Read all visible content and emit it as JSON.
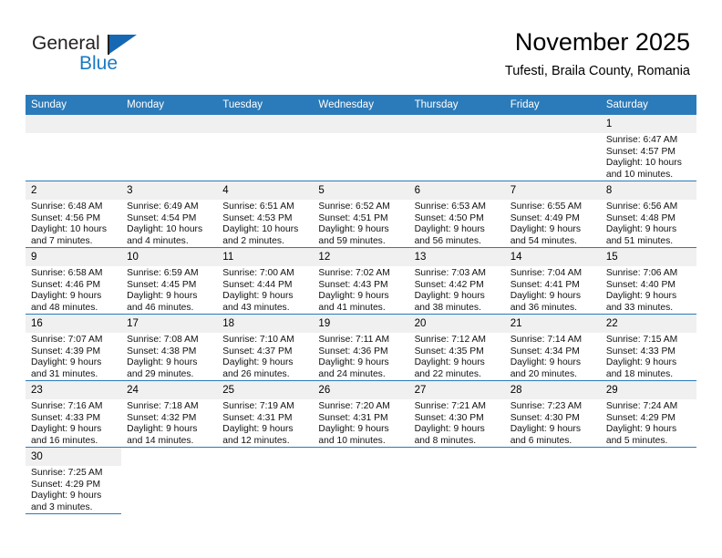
{
  "brand": {
    "name_top": "General",
    "name_bottom": "Blue",
    "accent_color": "#1668b3"
  },
  "header": {
    "title": "November 2025",
    "subtitle": "Tufesti, Braila County, Romania"
  },
  "theme": {
    "header_blue": "#2b7bba",
    "daynum_band": "#f0f0f0",
    "text": "#000000"
  },
  "weekday_headers": [
    "Sunday",
    "Monday",
    "Tuesday",
    "Wednesday",
    "Thursday",
    "Friday",
    "Saturday"
  ],
  "labels": {
    "sunrise": "Sunrise:",
    "sunset": "Sunset:",
    "daylight": "Daylight:"
  },
  "weeks": [
    [
      {
        "empty": true
      },
      {
        "empty": true
      },
      {
        "empty": true
      },
      {
        "empty": true
      },
      {
        "empty": true
      },
      {
        "empty": true
      },
      {
        "day": "1",
        "sunrise": "Sunrise: 6:47 AM",
        "sunset": "Sunset: 4:57 PM",
        "daylight": "Daylight: 10 hours and 10 minutes."
      }
    ],
    [
      {
        "day": "2",
        "sunrise": "Sunrise: 6:48 AM",
        "sunset": "Sunset: 4:56 PM",
        "daylight": "Daylight: 10 hours and 7 minutes."
      },
      {
        "day": "3",
        "sunrise": "Sunrise: 6:49 AM",
        "sunset": "Sunset: 4:54 PM",
        "daylight": "Daylight: 10 hours and 4 minutes."
      },
      {
        "day": "4",
        "sunrise": "Sunrise: 6:51 AM",
        "sunset": "Sunset: 4:53 PM",
        "daylight": "Daylight: 10 hours and 2 minutes."
      },
      {
        "day": "5",
        "sunrise": "Sunrise: 6:52 AM",
        "sunset": "Sunset: 4:51 PM",
        "daylight": "Daylight: 9 hours and 59 minutes."
      },
      {
        "day": "6",
        "sunrise": "Sunrise: 6:53 AM",
        "sunset": "Sunset: 4:50 PM",
        "daylight": "Daylight: 9 hours and 56 minutes."
      },
      {
        "day": "7",
        "sunrise": "Sunrise: 6:55 AM",
        "sunset": "Sunset: 4:49 PM",
        "daylight": "Daylight: 9 hours and 54 minutes."
      },
      {
        "day": "8",
        "sunrise": "Sunrise: 6:56 AM",
        "sunset": "Sunset: 4:48 PM",
        "daylight": "Daylight: 9 hours and 51 minutes."
      }
    ],
    [
      {
        "day": "9",
        "sunrise": "Sunrise: 6:58 AM",
        "sunset": "Sunset: 4:46 PM",
        "daylight": "Daylight: 9 hours and 48 minutes."
      },
      {
        "day": "10",
        "sunrise": "Sunrise: 6:59 AM",
        "sunset": "Sunset: 4:45 PM",
        "daylight": "Daylight: 9 hours and 46 minutes."
      },
      {
        "day": "11",
        "sunrise": "Sunrise: 7:00 AM",
        "sunset": "Sunset: 4:44 PM",
        "daylight": "Daylight: 9 hours and 43 minutes."
      },
      {
        "day": "12",
        "sunrise": "Sunrise: 7:02 AM",
        "sunset": "Sunset: 4:43 PM",
        "daylight": "Daylight: 9 hours and 41 minutes."
      },
      {
        "day": "13",
        "sunrise": "Sunrise: 7:03 AM",
        "sunset": "Sunset: 4:42 PM",
        "daylight": "Daylight: 9 hours and 38 minutes."
      },
      {
        "day": "14",
        "sunrise": "Sunrise: 7:04 AM",
        "sunset": "Sunset: 4:41 PM",
        "daylight": "Daylight: 9 hours and 36 minutes."
      },
      {
        "day": "15",
        "sunrise": "Sunrise: 7:06 AM",
        "sunset": "Sunset: 4:40 PM",
        "daylight": "Daylight: 9 hours and 33 minutes."
      }
    ],
    [
      {
        "day": "16",
        "sunrise": "Sunrise: 7:07 AM",
        "sunset": "Sunset: 4:39 PM",
        "daylight": "Daylight: 9 hours and 31 minutes."
      },
      {
        "day": "17",
        "sunrise": "Sunrise: 7:08 AM",
        "sunset": "Sunset: 4:38 PM",
        "daylight": "Daylight: 9 hours and 29 minutes."
      },
      {
        "day": "18",
        "sunrise": "Sunrise: 7:10 AM",
        "sunset": "Sunset: 4:37 PM",
        "daylight": "Daylight: 9 hours and 26 minutes."
      },
      {
        "day": "19",
        "sunrise": "Sunrise: 7:11 AM",
        "sunset": "Sunset: 4:36 PM",
        "daylight": "Daylight: 9 hours and 24 minutes."
      },
      {
        "day": "20",
        "sunrise": "Sunrise: 7:12 AM",
        "sunset": "Sunset: 4:35 PM",
        "daylight": "Daylight: 9 hours and 22 minutes."
      },
      {
        "day": "21",
        "sunrise": "Sunrise: 7:14 AM",
        "sunset": "Sunset: 4:34 PM",
        "daylight": "Daylight: 9 hours and 20 minutes."
      },
      {
        "day": "22",
        "sunrise": "Sunrise: 7:15 AM",
        "sunset": "Sunset: 4:33 PM",
        "daylight": "Daylight: 9 hours and 18 minutes."
      }
    ],
    [
      {
        "day": "23",
        "sunrise": "Sunrise: 7:16 AM",
        "sunset": "Sunset: 4:33 PM",
        "daylight": "Daylight: 9 hours and 16 minutes."
      },
      {
        "day": "24",
        "sunrise": "Sunrise: 7:18 AM",
        "sunset": "Sunset: 4:32 PM",
        "daylight": "Daylight: 9 hours and 14 minutes."
      },
      {
        "day": "25",
        "sunrise": "Sunrise: 7:19 AM",
        "sunset": "Sunset: 4:31 PM",
        "daylight": "Daylight: 9 hours and 12 minutes."
      },
      {
        "day": "26",
        "sunrise": "Sunrise: 7:20 AM",
        "sunset": "Sunset: 4:31 PM",
        "daylight": "Daylight: 9 hours and 10 minutes."
      },
      {
        "day": "27",
        "sunrise": "Sunrise: 7:21 AM",
        "sunset": "Sunset: 4:30 PM",
        "daylight": "Daylight: 9 hours and 8 minutes."
      },
      {
        "day": "28",
        "sunrise": "Sunrise: 7:23 AM",
        "sunset": "Sunset: 4:30 PM",
        "daylight": "Daylight: 9 hours and 6 minutes."
      },
      {
        "day": "29",
        "sunrise": "Sunrise: 7:24 AM",
        "sunset": "Sunset: 4:29 PM",
        "daylight": "Daylight: 9 hours and 5 minutes."
      }
    ],
    [
      {
        "day": "30",
        "sunrise": "Sunrise: 7:25 AM",
        "sunset": "Sunset: 4:29 PM",
        "daylight": "Daylight: 9 hours and 3 minutes."
      },
      {
        "blank": true
      },
      {
        "blank": true
      },
      {
        "blank": true
      },
      {
        "blank": true
      },
      {
        "blank": true
      },
      {
        "blank": true
      }
    ]
  ]
}
